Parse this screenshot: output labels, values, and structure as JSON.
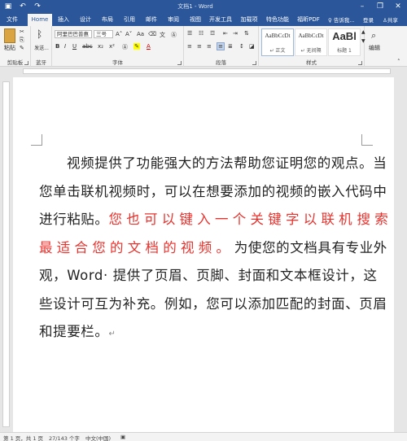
{
  "window": {
    "title": "文档1 - Word",
    "minimize_icon": "minimize-icon",
    "restore_icon": "restore-icon",
    "close_icon": "close-icon"
  },
  "quick_access": {
    "save_icon": "save-icon",
    "undo_icon": "undo-icon",
    "redo_icon": "redo-icon"
  },
  "tabs": [
    {
      "label": "文件"
    },
    {
      "label": "Home"
    },
    {
      "label": "插入"
    },
    {
      "label": "设计"
    },
    {
      "label": "布局"
    },
    {
      "label": "引用"
    },
    {
      "label": "邮件"
    },
    {
      "label": "审阅"
    },
    {
      "label": "视图"
    },
    {
      "label": "开发工具"
    },
    {
      "label": "加载项"
    },
    {
      "label": "特色功能"
    },
    {
      "label": "福昕PDF"
    }
  ],
  "tab_right": {
    "tellme": "♀ 告诉我...",
    "login": "登录",
    "share": "共享"
  },
  "ribbon": {
    "clipboard": {
      "paste": "粘贴",
      "label": "剪贴板"
    },
    "bluetooth": {
      "send": "发送...",
      "label": "蓝牙"
    },
    "font": {
      "name": "阿里巴巴普惠",
      "size": "三号",
      "grow": "A˄",
      "shrink": "A˅",
      "case": "Aa",
      "bold": "B",
      "italic": "I",
      "underline": "U",
      "strike": "abc",
      "sub": "x₂",
      "sup": "x²",
      "color": "A",
      "label": "字体"
    },
    "paragraph": {
      "label": "段落"
    },
    "styles": {
      "items": [
        {
          "sample": "AaBbCcDt",
          "name": "↵ 正文"
        },
        {
          "sample": "AaBbCcDt",
          "name": "↵ 无间隔"
        },
        {
          "sample": "AaBl",
          "name": "标题 1"
        }
      ],
      "label": "样式"
    },
    "editing": {
      "label": "编辑"
    }
  },
  "document": {
    "paragraph_normal_1": "视频提供了功能强大的方法帮助您证明您的观点。当您单击联机视频时，可以在想要添加的视频的嵌入代码中进行粘贴。",
    "line3_red": "您 也 可 以 键 入 一 个 关 键 字 以 联 机",
    "line4_red": "搜 索 最 适 合 您 的 文 档 的 视 频 。",
    "paragraph_normal_2": " 为使您的文档具有专业外观，Word· 提供了页眉、页脚、封面和文本框设计，这些设计可互为补充。例如，您可以添加匹配的封面、页眉和提要栏。",
    "end_mark": "↵"
  },
  "status": {
    "page": "第 1 页，共 1 页",
    "words": "27/143 个字",
    "lang": "中文(中国)"
  },
  "colors": {
    "ribbon_blue": "#2b579a",
    "highlight_red": "#e8322d"
  }
}
